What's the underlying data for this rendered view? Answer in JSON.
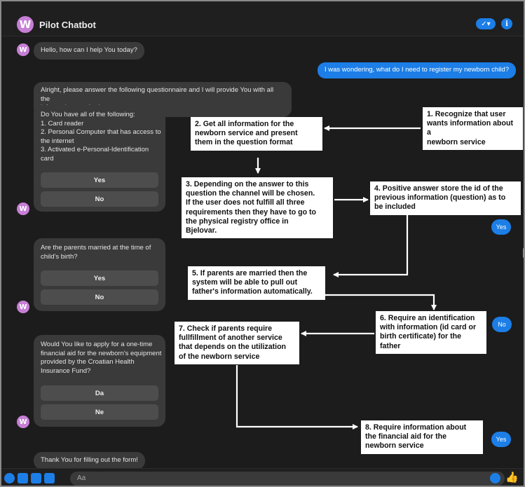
{
  "header": {
    "avatar_letter": "W",
    "title": "Pilot Chatbot",
    "check_icon": "✓▾",
    "info_icon": "i"
  },
  "messages": {
    "greeting": "Hello, how can I help You today?",
    "user_question": "I was wondering, what do I need to register my newborn child?",
    "instructions": "Alright, please answer the following questionnaire and I will provide You with all the\ninformation required:",
    "card1_text": "Do You have all of the following:\n1. Card reader\n2. Personal Computer that has access to\nthe internet\n3. Activated e-Personal-Identification\ncard",
    "card1_yes": "Yes",
    "card1_no": "No",
    "reply_yes": "Yes",
    "card2_text": "Are the parents married at the time of\nchild's birth?",
    "card2_yes": "Yes",
    "card2_no": "No",
    "reply_no": "No",
    "card3_text": "Would You like to apply for a one-time\nfinancial aid for the newborn's equipment\nprovided by the Croatian Health\nInsurance Fund?",
    "card3_da": "Da",
    "card3_ne": "Ne",
    "reply_yes2": "Yes",
    "thanks": "Thank You for filling out the form!"
  },
  "annotations": {
    "step1": "1. Recognize that user\nwants information about a\nnewborn service",
    "step2": "2. Get all information for the\nnewborn service and present\nthem in the question format",
    "step3": "3. Depending on the answer to this\nquestion the channel will be chosen.\nIf the user does not fulfill all three\nrequirements then they have to go to\nthe physical registry office in\nBjelovar.",
    "step4": "4. Positive answer store the id of the\nprevious information (question) as to\nbe included",
    "step5": "5. If parents are married then the\nsystem will be able to pull out\nfather's information automatically.",
    "step6": "6. Require an identification\nwith information (id card or\nbirth certificate) for the\nfather",
    "step7": "7. Check if parents require\nfullfillment of another service\nthat depends on the utilization\nof the newborn service",
    "step8": "8. Require information about\nthe financial aid for the\nnewborn service"
  },
  "composer": {
    "placeholder": "Aa",
    "icons": [
      "plus-icon",
      "image-icon",
      "sticker-icon",
      "gif-icon",
      "emoji-icon",
      "thumbs-up-icon"
    ]
  },
  "colors": {
    "background": "#1c1c1c",
    "bubble": "#3a3a3a",
    "accent": "#1c7ee6",
    "avatar": "#c77fd6",
    "note_bg": "#ffffff"
  }
}
